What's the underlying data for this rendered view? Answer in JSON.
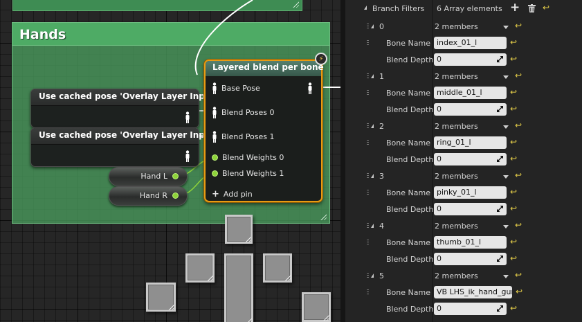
{
  "graph": {
    "comment_title": "Hands",
    "cache_nodes": [
      {
        "title": "Use cached pose 'Overlay Layer Input'"
      },
      {
        "title": "Use cached pose 'Overlay Layer Input'"
      }
    ],
    "variables": [
      {
        "label": "Hand L"
      },
      {
        "label": "Hand R"
      }
    ],
    "layered_blend": {
      "title": "Layered blend per bone",
      "pins": [
        "Base Pose",
        "Blend Poses 0",
        "Blend Poses 1",
        "Blend Weights 0",
        "Blend Weights 1"
      ],
      "add_pin": "Add pin"
    }
  },
  "details": {
    "branch_filters_label": "Branch Filters",
    "array_count": "6 Array elements",
    "elements": [
      {
        "index": "0",
        "members": "2 members",
        "bone_name_label": "Bone Name",
        "bone_name": "index_01_l",
        "blend_depth_label": "Blend Depth",
        "blend_depth": "0"
      },
      {
        "index": "1",
        "members": "2 members",
        "bone_name_label": "Bone Name",
        "bone_name": "middle_01_l",
        "blend_depth_label": "Blend Depth",
        "blend_depth": "0"
      },
      {
        "index": "2",
        "members": "2 members",
        "bone_name_label": "Bone Name",
        "bone_name": "ring_01_l",
        "blend_depth_label": "Blend Depth",
        "blend_depth": "0"
      },
      {
        "index": "3",
        "members": "2 members",
        "bone_name_label": "Bone Name",
        "bone_name": "pinky_01_l",
        "blend_depth_label": "Blend Depth",
        "blend_depth": "0"
      },
      {
        "index": "4",
        "members": "2 members",
        "bone_name_label": "Bone Name",
        "bone_name": "thumb_01_l",
        "blend_depth_label": "Blend Depth",
        "blend_depth": "0"
      },
      {
        "index": "5",
        "members": "2 members",
        "bone_name_label": "Bone Name",
        "bone_name": "VB LHS_ik_hand_gun",
        "blend_depth_label": "Blend Depth",
        "blend_depth": "0"
      }
    ]
  },
  "colors": {
    "comment_green": "#4eab65",
    "node_highlight": "#e79b12",
    "bool_pin": "#8ed33a",
    "reset_yellow": "#e8d04a"
  }
}
